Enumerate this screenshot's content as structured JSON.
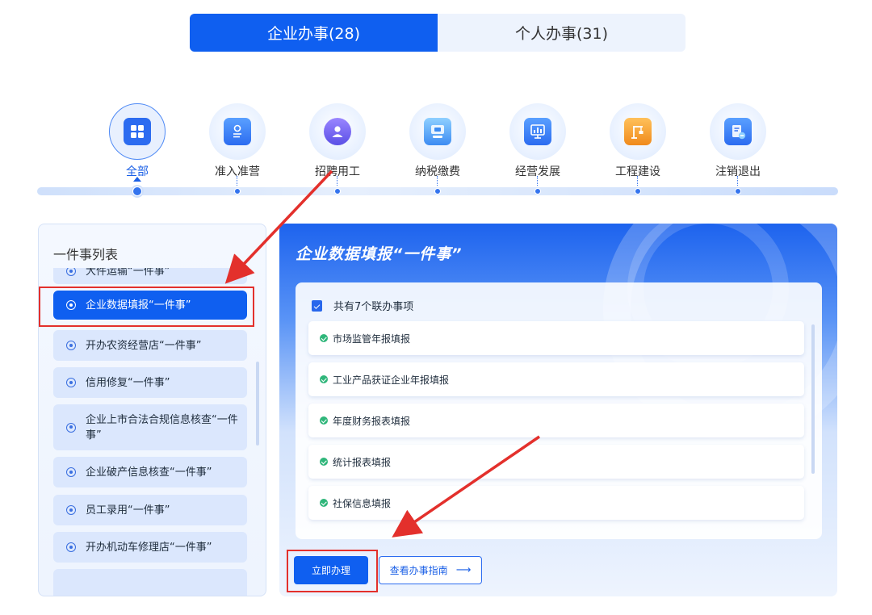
{
  "tabs": [
    {
      "label": "企业办事(28)",
      "active": true
    },
    {
      "label": "个人办事(31)",
      "active": false
    }
  ],
  "categories": [
    {
      "label": "全部",
      "icon": "grid-icon",
      "active": true
    },
    {
      "label": "准入准营",
      "icon": "license-icon"
    },
    {
      "label": "招聘用工",
      "icon": "user-icon"
    },
    {
      "label": "纳税缴费",
      "icon": "tax-icon"
    },
    {
      "label": "经营发展",
      "icon": "chart-icon"
    },
    {
      "label": "工程建设",
      "icon": "construction-icon"
    },
    {
      "label": "注销退出",
      "icon": "deregister-icon"
    }
  ],
  "list": {
    "title": "一件事列表",
    "items": [
      {
        "label": "大件运输“一件事”"
      },
      {
        "label": "企业数据填报“一件事”",
        "active": true
      },
      {
        "label": "开办农资经营店“一件事”"
      },
      {
        "label": "信用修复“一件事”"
      },
      {
        "label": "企业上市合法合规信息核查“一件事”"
      },
      {
        "label": "企业破产信息核查“一件事”"
      },
      {
        "label": "员工录用“一件事”"
      },
      {
        "label": "开办机动车修理店“一件事”"
      }
    ]
  },
  "detail": {
    "title": "企业数据填报“一件事”",
    "count_label": "共有7个联办事项",
    "matters": [
      "市场监管年报填报",
      "工业产品获证企业年报填报",
      "年度财务报表填报",
      "统计报表填报",
      "社保信息填报"
    ],
    "primary_button": "立即办理",
    "secondary_button": "查看办事指南",
    "secondary_arrow": "⟶"
  },
  "colors": {
    "primary": "#0f5ff0",
    "annotation": "#e3302c",
    "check": "#2fb67a"
  }
}
